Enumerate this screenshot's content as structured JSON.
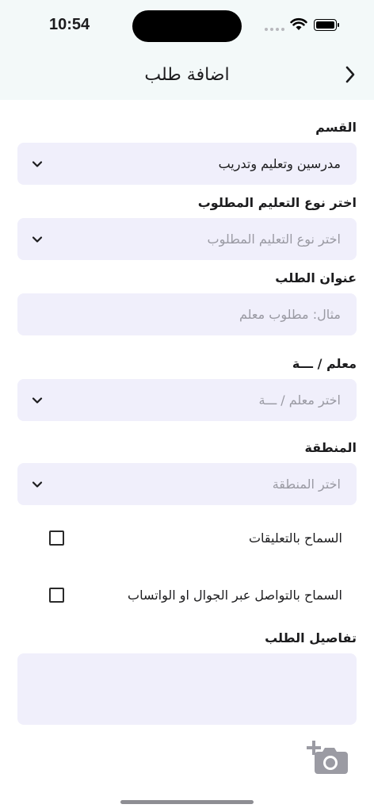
{
  "status_bar": {
    "time": "10:54"
  },
  "header": {
    "title": "اضافة طلب"
  },
  "form": {
    "section": {
      "label": "القسم",
      "value": "مدرسين وتعليم وتدريب"
    },
    "education_type": {
      "label": "اختر نوع التعليم المطلوب",
      "placeholder": "اختر نوع التعليم المطلوب"
    },
    "request_title": {
      "label": "عنوان الطلب",
      "placeholder": "مثال: مطلوب معلم"
    },
    "teacher": {
      "label": "معلم / ـــة",
      "placeholder": "اختر  معلم / ـــة"
    },
    "region": {
      "label": "المنطقة",
      "placeholder": "اختر  المنطقة"
    },
    "allow_comments": {
      "label": "السماح بالتعليقات",
      "checked": false
    },
    "allow_contact": {
      "label": "السماح بالتواصل عبر الجوال او الواتساب",
      "checked": false
    },
    "details": {
      "label": "تفاصيل الطلب",
      "value": ""
    }
  },
  "icons": {
    "back": "chevron-right-icon",
    "dropdown": "chevron-down-icon",
    "add_photo": "add-photo-camera-icon"
  },
  "colors": {
    "header_bg": "#f3f9f9",
    "field_bg": "#f0effb",
    "placeholder": "#9a9aa3",
    "camera_icon": "#9b9ba3"
  }
}
